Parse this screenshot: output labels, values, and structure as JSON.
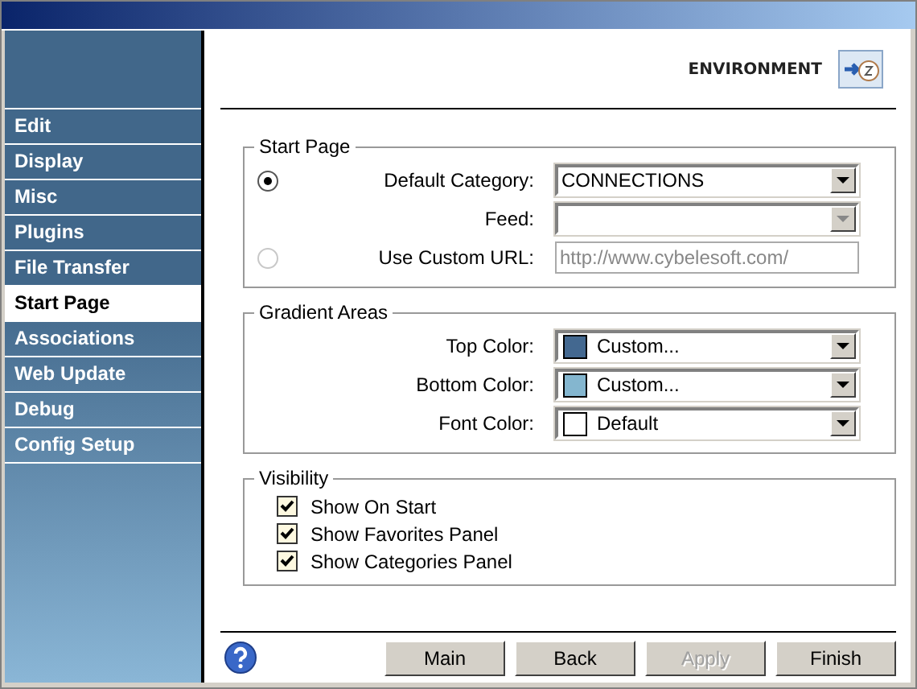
{
  "sidebar": {
    "items": [
      {
        "label": "Edit",
        "selected": false
      },
      {
        "label": "Display",
        "selected": false
      },
      {
        "label": "Misc",
        "selected": false
      },
      {
        "label": "Plugins",
        "selected": false
      },
      {
        "label": "File Transfer",
        "selected": false
      },
      {
        "label": "Start Page",
        "selected": true
      },
      {
        "label": "Associations",
        "selected": false
      },
      {
        "label": "Web Update",
        "selected": false
      },
      {
        "label": "Debug",
        "selected": false
      },
      {
        "label": "Config Setup",
        "selected": false
      }
    ]
  },
  "header": {
    "title": "ENVIRONMENT"
  },
  "start_page": {
    "title": "Start Page",
    "rows": [
      {
        "kind": "dropdown",
        "label": "Default Category:",
        "value": "CONNECTIONS",
        "disabled": false,
        "radio": {
          "selected": true
        }
      },
      {
        "kind": "dropdown",
        "label": "Feed:",
        "disabled": true
      },
      {
        "kind": "text",
        "label": "Use Custom URL:",
        "value": "http://www.cybelesoft.com/",
        "disabled": true,
        "radio": {
          "selected": false
        }
      }
    ]
  },
  "gradient_areas": {
    "title": "Gradient Areas",
    "rows": [
      {
        "label": "Top Color:",
        "value": "Custom...",
        "color": "#436890"
      },
      {
        "label": "Bottom Color:",
        "value": "Custom...",
        "color": "#84b6cf"
      },
      {
        "label": "Font Color:",
        "value": "Default",
        "color": "#ffffff"
      }
    ]
  },
  "visibility": {
    "title": "Visibility",
    "options": [
      {
        "label": "Show On Start",
        "checked": true
      },
      {
        "label": "Show Favorites Panel",
        "checked": true
      },
      {
        "label": "Show Categories Panel",
        "checked": true
      }
    ]
  },
  "buttons": [
    {
      "label": "Main",
      "disabled": false
    },
    {
      "label": "Back",
      "disabled": false
    },
    {
      "label": "Apply",
      "disabled": true
    },
    {
      "label": "Finish",
      "disabled": false
    }
  ]
}
